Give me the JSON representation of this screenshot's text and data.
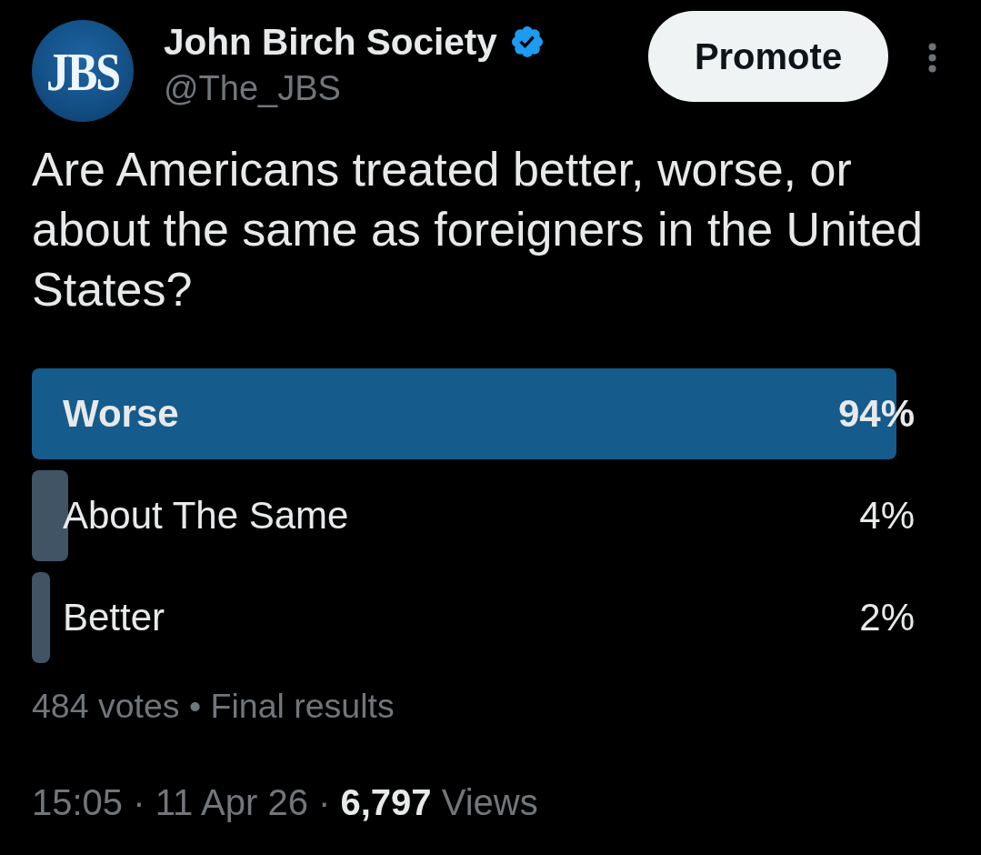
{
  "author": {
    "avatar_text": "JBS",
    "name": "John Birch Society",
    "verified": true,
    "handle": "@The_JBS"
  },
  "promote_button": {
    "label": "Promote"
  },
  "question": "Are Americans treated better, worse, or about the same as foreigners in the United States?",
  "poll": {
    "options": [
      {
        "label": "Worse",
        "percentage": "94%",
        "level": 0.94,
        "winner": true
      },
      {
        "label": "About The Same",
        "percentage": "4%",
        "level": 0.04,
        "winner": false
      },
      {
        "label": "Better",
        "percentage": "2%",
        "level": 0.02,
        "winner": false
      }
    ],
    "summary": "484 votes • Final results"
  },
  "meta": "15:05 · 11 Apr 26 · **6,797** Views"
}
